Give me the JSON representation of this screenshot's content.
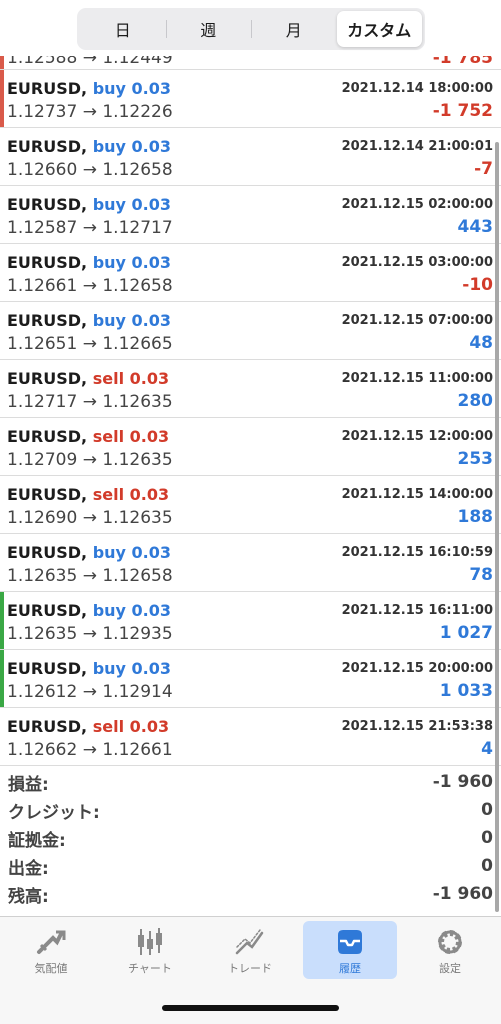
{
  "segments": [
    "日",
    "週",
    "月",
    "カスタム"
  ],
  "partial_top": {
    "prices": "1.12588 → 1.12449",
    "profit": "-1 785"
  },
  "trades": [
    {
      "symbol": "EURUSD,",
      "side": "buy",
      "lot": "buy 0.03",
      "time": "2021.12.14 18:00:00",
      "prices": "1.12737 → 1.12226",
      "profit": "-1 752",
      "sign": "neg",
      "accent": "#d95a4a"
    },
    {
      "symbol": "EURUSD,",
      "side": "buy",
      "lot": "buy 0.03",
      "time": "2021.12.14 21:00:01",
      "prices": "1.12660 → 1.12658",
      "profit": "-7",
      "sign": "neg",
      "accent": ""
    },
    {
      "symbol": "EURUSD,",
      "side": "buy",
      "lot": "buy 0.03",
      "time": "2021.12.15 02:00:00",
      "prices": "1.12587 → 1.12717",
      "profit": "443",
      "sign": "pos",
      "accent": ""
    },
    {
      "symbol": "EURUSD,",
      "side": "buy",
      "lot": "buy 0.03",
      "time": "2021.12.15 03:00:00",
      "prices": "1.12661 → 1.12658",
      "profit": "-10",
      "sign": "neg",
      "accent": ""
    },
    {
      "symbol": "EURUSD,",
      "side": "buy",
      "lot": "buy 0.03",
      "time": "2021.12.15 07:00:00",
      "prices": "1.12651 → 1.12665",
      "profit": "48",
      "sign": "pos",
      "accent": ""
    },
    {
      "symbol": "EURUSD,",
      "side": "sell",
      "lot": "sell 0.03",
      "time": "2021.12.15 11:00:00",
      "prices": "1.12717 → 1.12635",
      "profit": "280",
      "sign": "pos",
      "accent": ""
    },
    {
      "symbol": "EURUSD,",
      "side": "sell",
      "lot": "sell 0.03",
      "time": "2021.12.15 12:00:00",
      "prices": "1.12709 → 1.12635",
      "profit": "253",
      "sign": "pos",
      "accent": ""
    },
    {
      "symbol": "EURUSD,",
      "side": "sell",
      "lot": "sell 0.03",
      "time": "2021.12.15 14:00:00",
      "prices": "1.12690 → 1.12635",
      "profit": "188",
      "sign": "pos",
      "accent": ""
    },
    {
      "symbol": "EURUSD,",
      "side": "buy",
      "lot": "buy 0.03",
      "time": "2021.12.15 16:10:59",
      "prices": "1.12635 → 1.12658",
      "profit": "78",
      "sign": "pos",
      "accent": ""
    },
    {
      "symbol": "EURUSD,",
      "side": "buy",
      "lot": "buy 0.03",
      "time": "2021.12.15 16:11:00",
      "prices": "1.12635 → 1.12935",
      "profit": "1 027",
      "sign": "pos",
      "accent": "#3aa845"
    },
    {
      "symbol": "EURUSD,",
      "side": "buy",
      "lot": "buy 0.03",
      "time": "2021.12.15 20:00:00",
      "prices": "1.12612 → 1.12914",
      "profit": "1 033",
      "sign": "pos",
      "accent": "#3aa845"
    },
    {
      "symbol": "EURUSD,",
      "side": "sell",
      "lot": "sell 0.03",
      "time": "2021.12.15 21:53:38",
      "prices": "1.12662 → 1.12661",
      "profit": "4",
      "sign": "pos",
      "accent": ""
    }
  ],
  "summary": [
    {
      "label": "損益:",
      "value": "-1 960"
    },
    {
      "label": "クレジット:",
      "value": "0"
    },
    {
      "label": "証拠金:",
      "value": "0"
    },
    {
      "label": "出金:",
      "value": "0"
    },
    {
      "label": "残高:",
      "value": "-1 960"
    }
  ],
  "tabs": [
    {
      "label": "気配値",
      "icon": "quotes-icon",
      "active": false
    },
    {
      "label": "チャート",
      "icon": "chart-icon",
      "active": false
    },
    {
      "label": "トレード",
      "icon": "trade-icon",
      "active": false
    },
    {
      "label": "履歴",
      "icon": "history-icon",
      "active": true
    },
    {
      "label": "設定",
      "icon": "settings-icon",
      "active": false
    }
  ],
  "colors": {
    "buy": "#2f79d8",
    "sell": "#d23b2a",
    "profit_positive": "#2f79d8",
    "profit_negative": "#d23b2a",
    "tab_active_bg": "#c9defc"
  }
}
